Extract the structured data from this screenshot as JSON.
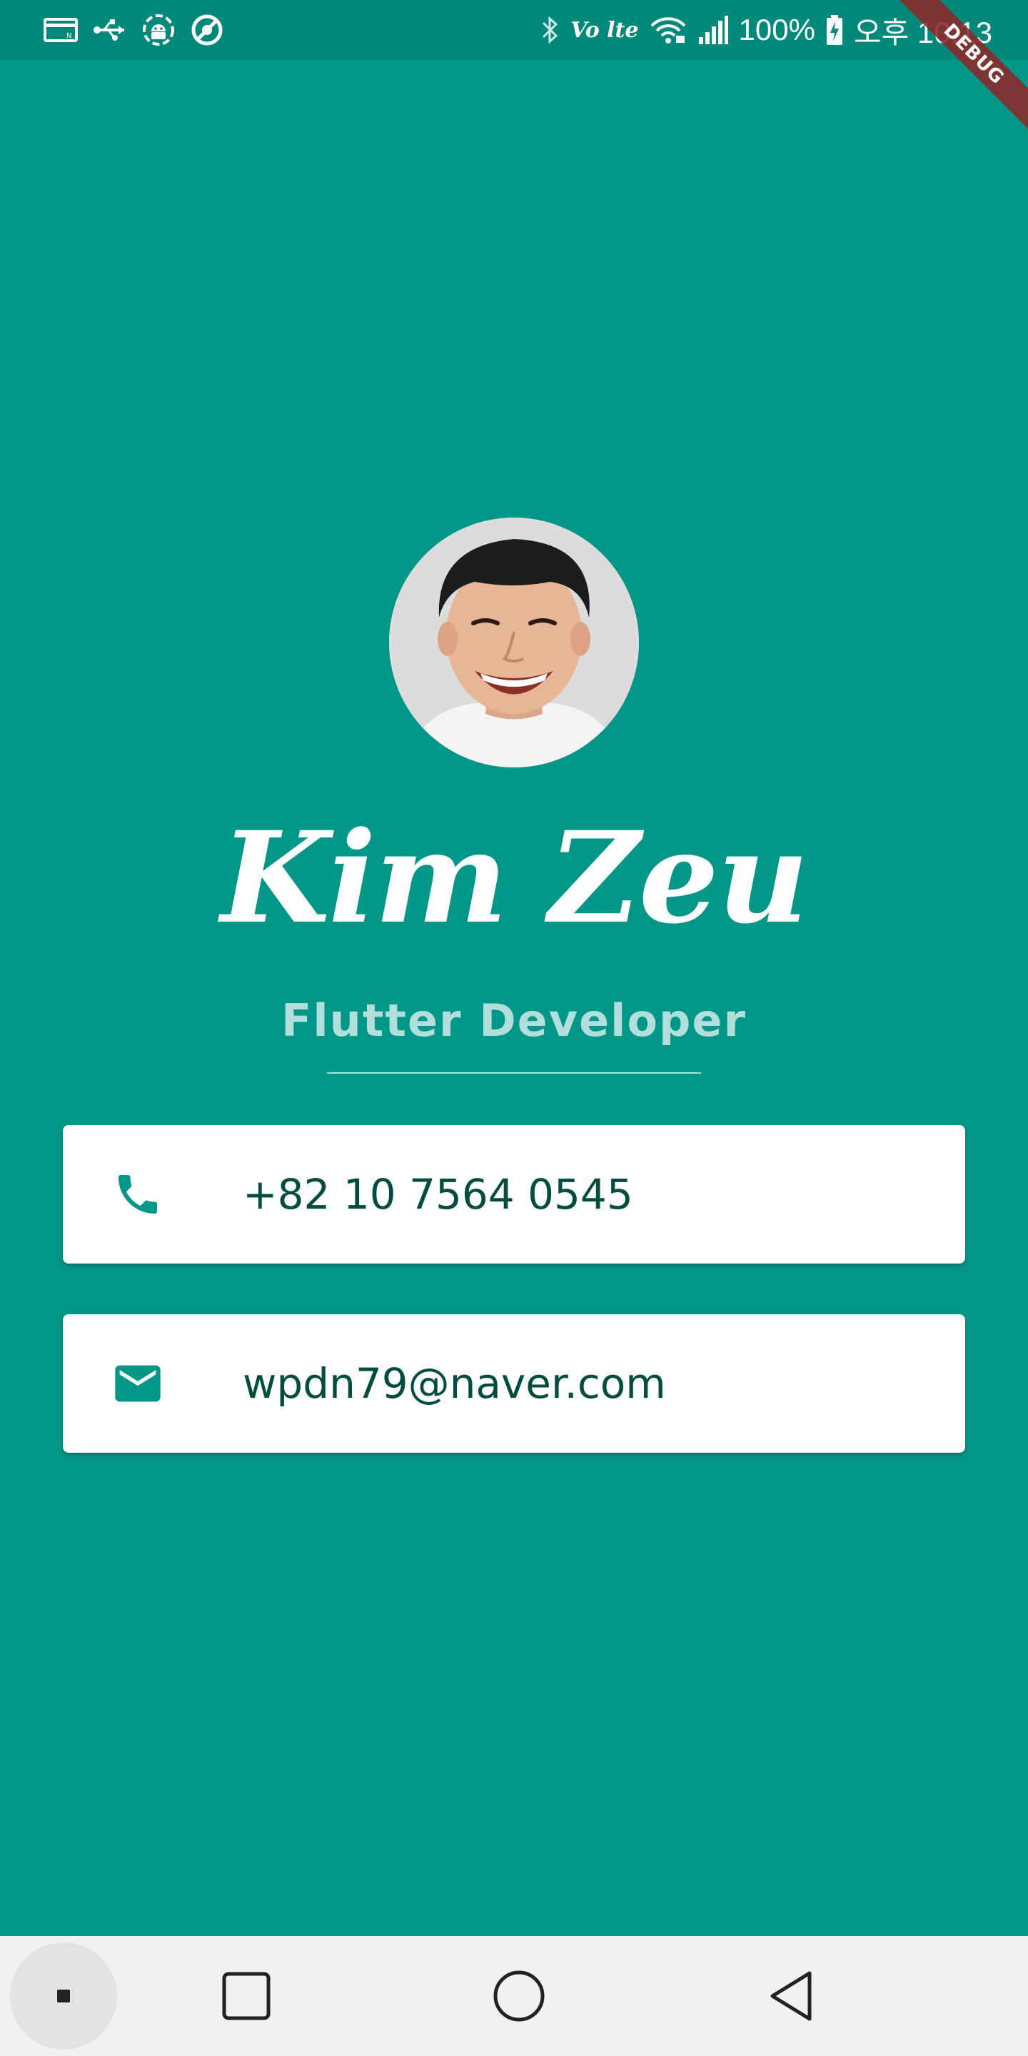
{
  "status_bar": {
    "left_icons": [
      "nfc-card-icon",
      "usb-icon",
      "android-debug-icon",
      "data-saver-icon"
    ],
    "right_icons": [
      "bluetooth-icon",
      "volte-icon",
      "wifi-icon",
      "signal-icon",
      "battery-icon"
    ],
    "volte_label": "Vo lte",
    "battery": "100%",
    "time": "오후 10:13"
  },
  "debug_banner": {
    "label": "DEBUG"
  },
  "profile": {
    "name": "Kim Zeu",
    "title": "Flutter Developer"
  },
  "contacts": {
    "phone": {
      "icon": "phone-icon",
      "value": "+82 10 7564 0545"
    },
    "email": {
      "icon": "mail-icon",
      "value": "wpdn79@naver.com"
    }
  },
  "nav_bar": {
    "buttons": [
      "dot-button",
      "recents-button",
      "home-button",
      "back-button"
    ]
  },
  "colors": {
    "background": "#009688",
    "status_bar": "#00897b",
    "subtitle": "#b2dfdb",
    "card_text": "#004d40",
    "card_icon": "#009688",
    "card_bg": "#ffffff"
  }
}
